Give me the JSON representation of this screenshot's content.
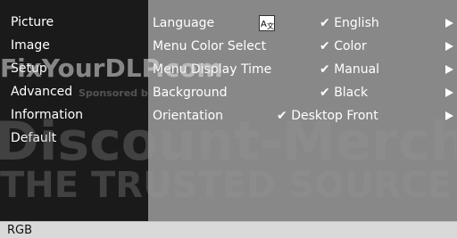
{
  "menu": {
    "categories": [
      "Picture",
      "Image",
      "Setup",
      "Advanced",
      "Information",
      "Default"
    ]
  },
  "settings": [
    {
      "label": "Language",
      "value": "English"
    },
    {
      "label": "Menu Color Select",
      "value": "Color"
    },
    {
      "label": "Menu Display Time",
      "value": "Manual"
    },
    {
      "label": "Background",
      "value": "Black"
    },
    {
      "label": "Orientation",
      "value": "Desktop Front"
    }
  ],
  "check_mark": "✔",
  "status_bar": {
    "source": "RGB"
  },
  "watermark": {
    "site": "FixYourDLP.com",
    "sponsor": "Sponsored by",
    "brand": "Discount-Merchant.com",
    "tagline": "THE TRUSTED SOURCE FOR PROJECTOR LAMPS AND ACCESSORIES"
  },
  "icons": {
    "language": "language-icon",
    "arrow": "right-arrow-icon"
  },
  "colors": {
    "menu_bg": "#1a1a1a",
    "panel_bg": "#888888",
    "text": "#ffffff",
    "status_bg": "#d9d9d9"
  }
}
